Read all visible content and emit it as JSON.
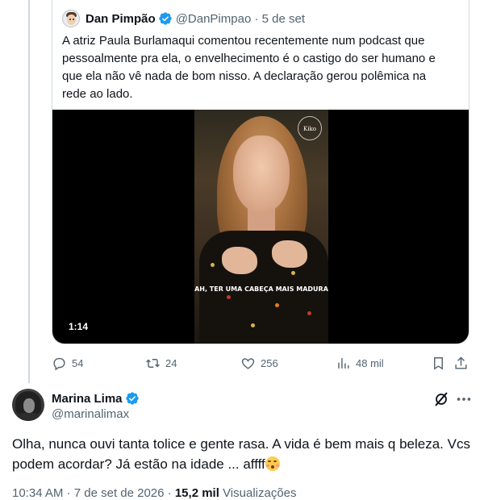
{
  "quoted_tweet": {
    "author_name": "Dan Pimpão",
    "handle": "@DanPimpao",
    "date": "5 de set",
    "text": "A atriz Paula Burlamaqui comentou recentemente num podcast que pessoalmente pra ela, o envelhecimento é o castigo do ser humano e que ela não vê nada de bom nisso. A declaração gerou polêmica na rede ao lado.",
    "video": {
      "caption": "AH, TER UMA CABEÇA MAIS MADURA",
      "logo_text": "Kiko",
      "duration": "1:14"
    }
  },
  "actions": {
    "replies": "54",
    "retweets": "24",
    "likes": "256",
    "views": "48 mil"
  },
  "reply": {
    "author_name": "Marina Lima",
    "handle": "@marinalimax",
    "text": "Olha, nunca ouvi tanta tolice e gente rasa. A vida é bem mais q beleza. Vcs podem acordar? Já estão na idade ... affff",
    "time": "10:34 AM",
    "date": "7 de set de 2026",
    "views_count": "15,2 mil",
    "views_label": "Visualizações"
  },
  "icons": {
    "verified": "verified-badge-icon",
    "reply": "comment-bubble-icon",
    "retweet": "retweet-icon",
    "like": "heart-icon",
    "views": "bar-chart-icon",
    "bookmark": "bookmark-icon",
    "share": "share-icon",
    "grok": "grok-icon",
    "more": "more-dots-icon",
    "emoji": "kissing-face-emoji"
  },
  "colors": {
    "verified_blue": "#1d9bf0",
    "secondary_text": "#536471",
    "primary_text": "#0f1419"
  }
}
